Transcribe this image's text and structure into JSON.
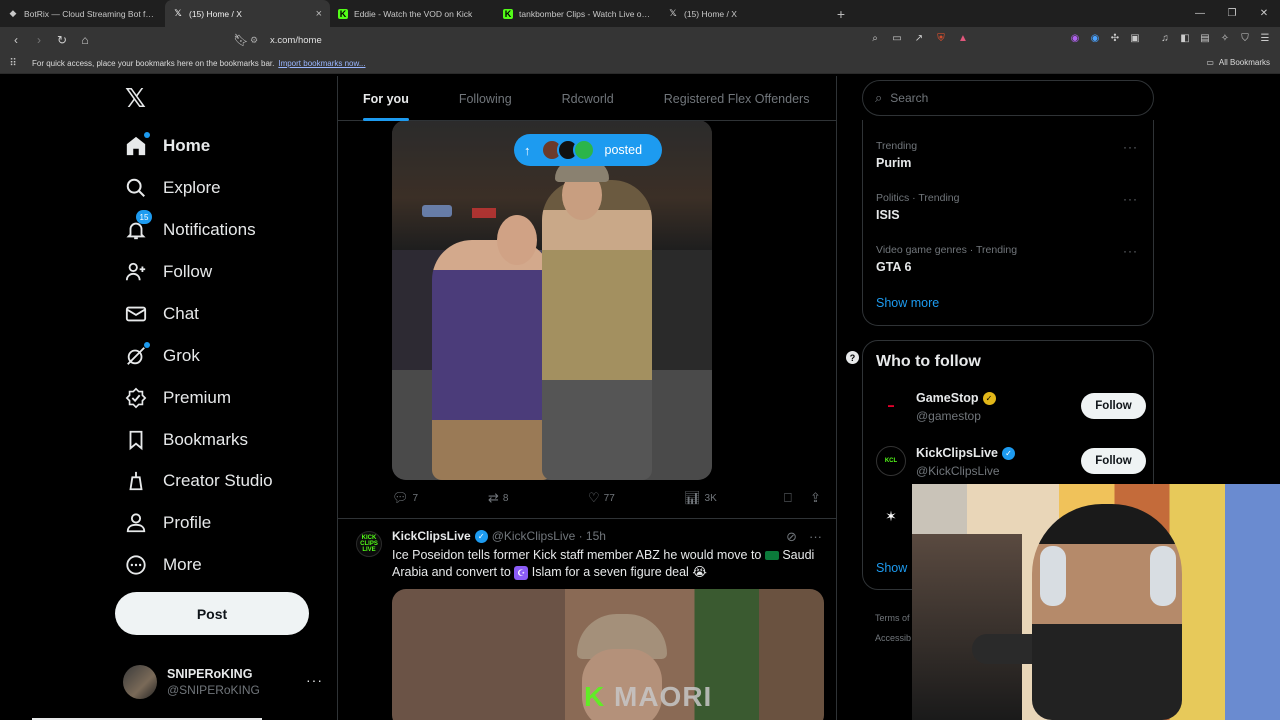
{
  "browser": {
    "tabs": [
      {
        "title": "BotRix — Cloud Streaming Bot for Twitch",
        "active": false,
        "favicon": "botrix-icon"
      },
      {
        "title": "(15) Home / X",
        "active": true,
        "favicon": "x-icon"
      },
      {
        "title": "Eddie - Watch the VOD on Kick",
        "active": false,
        "favicon": "kick-icon"
      },
      {
        "title": "tankbomber Clips - Watch Live on Kick",
        "active": false,
        "favicon": "kick-icon"
      },
      {
        "title": "(15) Home / X",
        "active": false,
        "favicon": "x-icon"
      }
    ],
    "close_glyph": "×",
    "new_tab_glyph": "+",
    "url": "x.com/home",
    "bookmarks_bar": {
      "message": "For quick access, place your bookmarks here on the bookmarks bar.",
      "import_link": "Import bookmarks now...",
      "all_bookmarks": "All Bookmarks"
    }
  },
  "nav": {
    "items": [
      {
        "label": "Home",
        "icon": "home-icon"
      },
      {
        "label": "Explore",
        "icon": "search-icon"
      },
      {
        "label": "Notifications",
        "icon": "bell-icon"
      },
      {
        "label": "Follow",
        "icon": "add-user-icon"
      },
      {
        "label": "Chat",
        "icon": "mail-icon"
      },
      {
        "label": "Grok",
        "icon": "grok-icon"
      },
      {
        "label": "Premium",
        "icon": "verified-icon"
      },
      {
        "label": "Bookmarks",
        "icon": "bookmark-icon"
      },
      {
        "label": "Creator Studio",
        "icon": "creator-icon"
      },
      {
        "label": "Profile",
        "icon": "person-icon"
      },
      {
        "label": "More",
        "icon": "more-circle-icon"
      }
    ],
    "notifications_count": "15",
    "post_label": "Post",
    "account": {
      "name": "SNIPERoKING",
      "handle": "@SNIPERoKING"
    }
  },
  "feed": {
    "tabs": [
      "For you",
      "Following",
      "Rdcworld",
      "Registered Flex Offenders"
    ],
    "posted_pill": "posted",
    "post1_stats": {
      "replies": "7",
      "reposts": "8",
      "likes": "77",
      "views": "3K"
    },
    "post2": {
      "name": "KickClipsLive",
      "handle": "@KickClipsLive",
      "time": "15h",
      "avatar_text": "KICK CLIPS LIVE",
      "text_a": "Ice Poseidon tells former Kick staff member ABZ he would move to",
      "text_b": "Saudi Arabia and convert to",
      "text_c": "Islam for a seven figure deal",
      "media_watermark_k": "K",
      "media_watermark": "MAORI"
    }
  },
  "sidebar": {
    "search_placeholder": "Search",
    "trends": [
      {
        "category": "Trending",
        "topic": "Purim"
      },
      {
        "category": "Politics · Trending",
        "topic": "ISIS"
      },
      {
        "category": "Video game genres · Trending",
        "topic": "GTA 6"
      }
    ],
    "show_more": "Show more",
    "who_to_follow": "Who to follow",
    "suggestions": [
      {
        "name": "GameStop",
        "handle": "@gamestop",
        "badge": "gold",
        "button": "Follow"
      },
      {
        "name": "KickClipsLive",
        "handle": "@KickClipsLive",
        "badge": "blue",
        "button": "Follow"
      }
    ],
    "show_more_2": "Show",
    "footer_a": "Terms of",
    "footer_b": "Accessib"
  },
  "colors": {
    "accent": "#1d9bf0",
    "kick_green": "#53fc18",
    "background": "#000000"
  }
}
